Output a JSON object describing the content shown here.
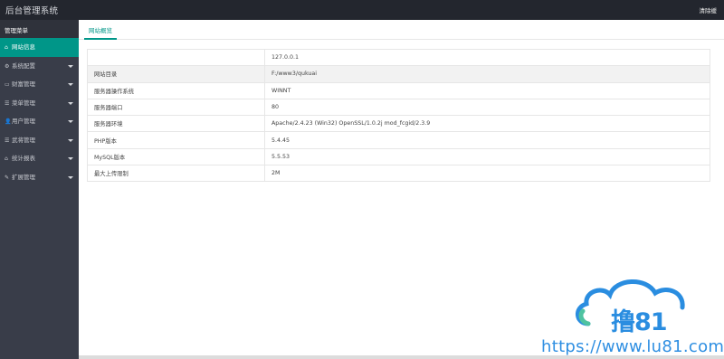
{
  "header": {
    "title": "后台管理系统",
    "right_link": "清除缓"
  },
  "sidebar": {
    "heading": "管理菜单",
    "items": [
      {
        "icon": "⌂",
        "label": "网站信息",
        "active": true,
        "has_caret": false
      },
      {
        "icon": "⚙",
        "label": "系统配置",
        "has_caret": true
      },
      {
        "icon": "▭",
        "label": "财富管理",
        "has_caret": true
      },
      {
        "icon": "☰",
        "label": "菜单管理",
        "has_caret": true
      },
      {
        "icon": "👤",
        "label": "用户管理",
        "has_caret": true
      },
      {
        "icon": "☰",
        "label": "武将管理",
        "has_caret": true
      },
      {
        "icon": "⌂",
        "label": "统计报表",
        "has_caret": true
      },
      {
        "icon": "✎",
        "label": "扩展管理",
        "has_caret": true
      }
    ]
  },
  "tabs": [
    {
      "label": "网站概览",
      "active": true
    }
  ],
  "info_table": {
    "rows": [
      {
        "key": "",
        "value": "127.0.0.1"
      },
      {
        "key": "网站目录",
        "value": "F:/www3/qukuai"
      },
      {
        "key": "服务器操作系统",
        "value": "WINNT"
      },
      {
        "key": "服务器端口",
        "value": "80"
      },
      {
        "key": "服务器环境",
        "value": "Apache/2.4.23 (Win32) OpenSSL/1.0.2j mod_fcgid/2.3.9"
      },
      {
        "key": "PHP版本",
        "value": "5.4.45"
      },
      {
        "key": "MySQL版本",
        "value": "5.5.53"
      },
      {
        "key": "最大上传限制",
        "value": "2M"
      }
    ]
  },
  "watermark": {
    "brand": "撸81",
    "url": "https://www.lu81.com"
  },
  "colors": {
    "topbar": "#23262e",
    "sidebar": "#393d49",
    "accent": "#009688",
    "watermark": "#2a8de0"
  }
}
